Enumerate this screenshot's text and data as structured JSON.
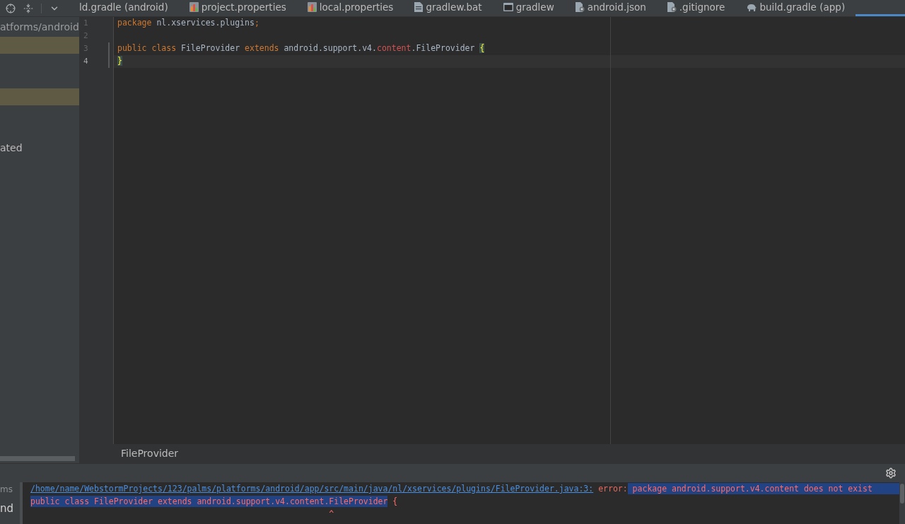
{
  "editor_tabs": [
    {
      "label": "ld.gradle (android)",
      "selected": false
    },
    {
      "label": "project.properties",
      "kind": "properties",
      "selected": false
    },
    {
      "label": "local.properties",
      "kind": "properties",
      "selected": false
    },
    {
      "label": "gradlew.bat",
      "kind": "batch",
      "selected": false
    },
    {
      "label": "gradlew",
      "kind": "script",
      "selected": false
    },
    {
      "label": "android.json",
      "kind": "json",
      "selected": false
    },
    {
      "label": ".gitignore",
      "kind": "ignore",
      "selected": false
    },
    {
      "label": "build.gradle (app)",
      "kind": "gradle",
      "selected": false
    },
    {
      "selected": true
    }
  ],
  "project_panel": {
    "path": "atforms/android",
    "rows": [
      {
        "highlighted": true
      },
      {
        "highlighted": false
      },
      {
        "highlighted": false
      },
      {
        "highlighted": true
      },
      {
        "highlighted": false
      },
      {
        "highlighted": false
      },
      {
        "text": "ated",
        "highlighted": false
      }
    ]
  },
  "editor": {
    "lines": [
      {
        "number": "1",
        "current": false,
        "changed": false,
        "tokens": [
          {
            "text": "package ",
            "kind": "keyword"
          },
          {
            "text": "nl.xservices.plugins"
          },
          {
            "text": ";",
            "kind": "punctuation"
          }
        ]
      },
      {
        "number": "2",
        "current": false,
        "changed": false
      },
      {
        "number": "3",
        "current": false,
        "changed": true,
        "tokens": [
          {
            "text": "public class ",
            "kind": "keyword"
          },
          {
            "text": "FileProvider "
          },
          {
            "text": "extends ",
            "kind": "keyword"
          },
          {
            "text": "android.support.v4."
          },
          {
            "text": "content",
            "kind": "unresolved"
          },
          {
            "text": ".FileProvider "
          },
          {
            "text": "{",
            "kind": "brace_match"
          }
        ]
      },
      {
        "number": "4",
        "current": true,
        "changed": true,
        "tokens": [
          {
            "text": "}",
            "kind": "brace_match"
          }
        ]
      }
    ]
  },
  "breadcrumb": {
    "items": [
      "FileProvider"
    ]
  },
  "tool_window": {
    "side_labels": [
      {
        "text": "ms",
        "kind": "caption"
      },
      {
        "text": "nd",
        "kind": "item"
      }
    ],
    "console_lines": [
      {
        "segments": [
          {
            "text": "/home/name/WebstormProjects/123/palms/platforms/android/app/src/main/java/nl/xservices/plugins/FileProvider.java:3:",
            "kind": "link",
            "selected": false
          },
          {
            "text": " error:",
            "kind": "label",
            "selected": false
          },
          {
            "text": " package android.support.v4.content does not exist",
            "kind": "message",
            "selected": true
          }
        ]
      },
      {
        "segments": [
          {
            "text": "public class FileProvider extends android.support.v4.content.FileProvider",
            "kind": "source",
            "selected": true
          },
          {
            "text": " {",
            "kind": "source",
            "selected": false
          }
        ]
      },
      {
        "segments": [
          {
            "text": "^",
            "kind": "caret",
            "selected": false
          }
        ]
      }
    ]
  }
}
